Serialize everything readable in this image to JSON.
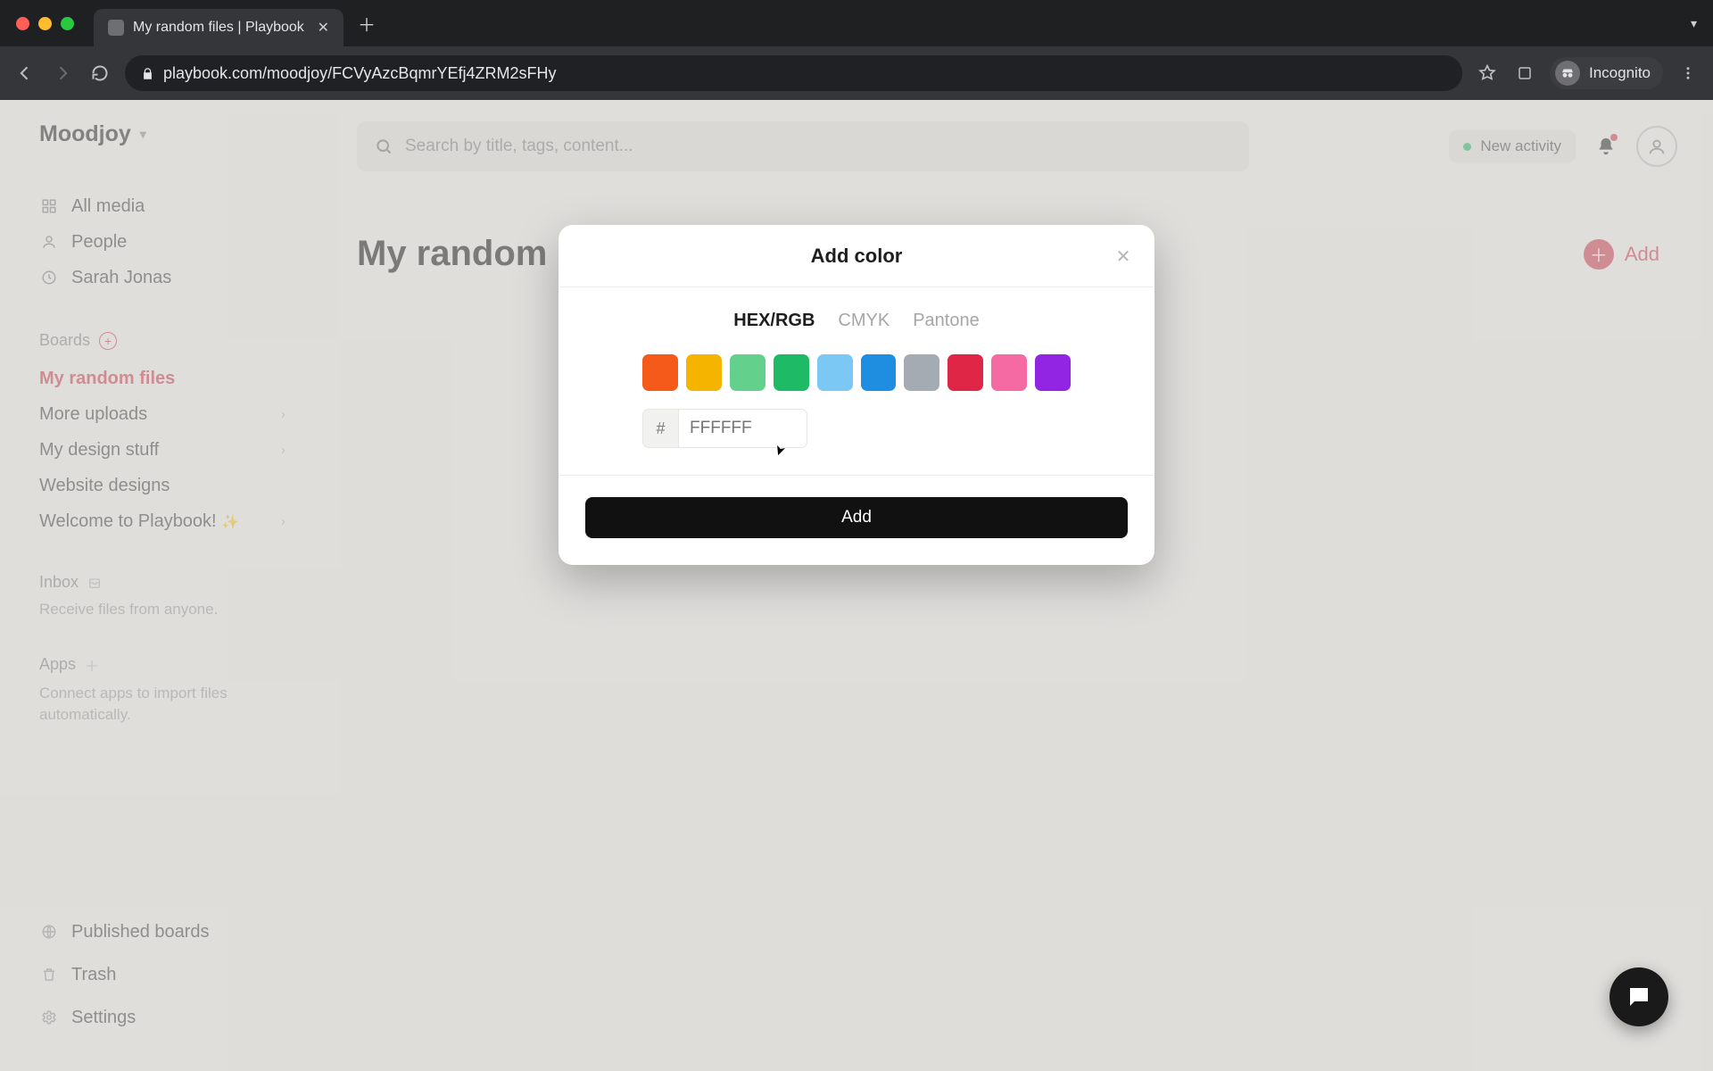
{
  "browser": {
    "tab_title": "My random files | Playbook",
    "url": "playbook.com/moodjoy/FCVyAzcBqmrYEfj4ZRM2sFHy",
    "incognito_label": "Incognito"
  },
  "header": {
    "workspace": "Moodjoy",
    "search_placeholder": "Search by title, tags, content...",
    "activity_label": "New activity"
  },
  "sidebar": {
    "main_nav": [
      {
        "label": "All media",
        "icon": "grid-icon"
      },
      {
        "label": "People",
        "icon": "person-icon"
      },
      {
        "label": "Sarah Jonas",
        "icon": "clock-icon"
      }
    ],
    "boards_label": "Boards",
    "boards": [
      {
        "label": "My random files",
        "active": true,
        "caret": false
      },
      {
        "label": "More uploads",
        "active": false,
        "caret": true
      },
      {
        "label": "My design stuff",
        "active": false,
        "caret": true
      },
      {
        "label": "Website designs",
        "active": false,
        "caret": false
      },
      {
        "label": "Welcome to Playbook!",
        "active": false,
        "caret": true,
        "sparkle": true
      }
    ],
    "inbox": {
      "label": "Inbox",
      "desc": "Receive files from anyone."
    },
    "apps": {
      "label": "Apps",
      "desc": "Connect apps to import files automatically."
    },
    "footer": [
      {
        "label": "Published boards",
        "icon": "globe-icon"
      },
      {
        "label": "Trash",
        "icon": "trash-icon"
      },
      {
        "label": "Settings",
        "icon": "gear-icon"
      }
    ]
  },
  "page": {
    "title": "My random",
    "add_label": "Add"
  },
  "modal": {
    "title": "Add color",
    "tabs": {
      "hex": "HEX/RGB",
      "cmyk": "CMYK",
      "pantone": "Pantone"
    },
    "swatches": [
      "#f55a1a",
      "#f5b400",
      "#63d18c",
      "#1fba66",
      "#7cc8f5",
      "#1f8de0",
      "#a4abb3",
      "#e02646",
      "#f56aa3",
      "#9224e3"
    ],
    "hash": "#",
    "hex_placeholder": "FFFFFF",
    "add_label": "Add"
  }
}
